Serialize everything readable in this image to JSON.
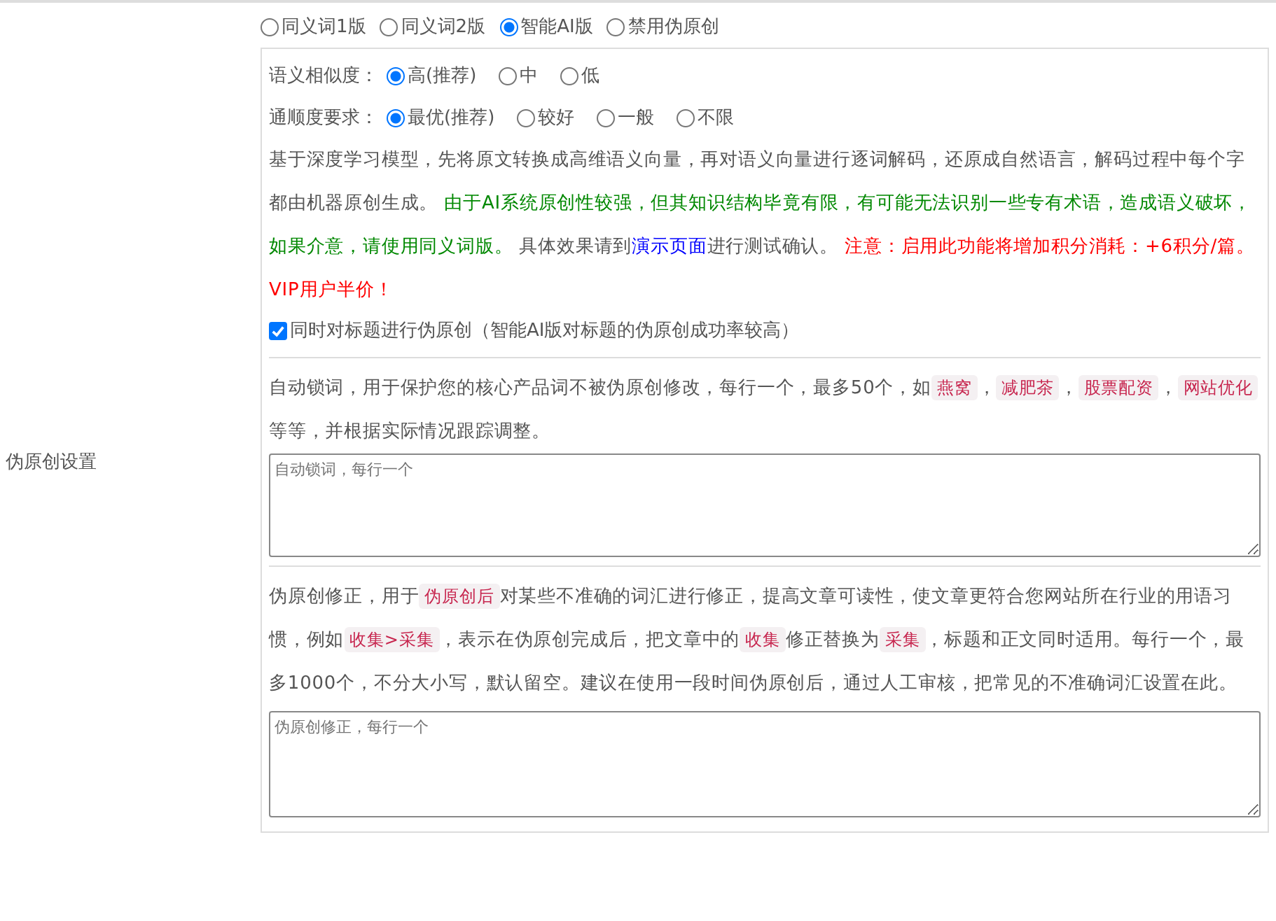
{
  "section_label": "伪原创设置",
  "modes": [
    {
      "label": "同义词1版",
      "selected": false
    },
    {
      "label": "同义词2版",
      "selected": false
    },
    {
      "label": "智能AI版",
      "selected": true
    },
    {
      "label": "禁用伪原创",
      "selected": false
    }
  ],
  "similarity": {
    "label": "语义相似度：",
    "options": [
      {
        "label": "高(推荐)",
        "selected": true
      },
      {
        "label": "中",
        "selected": false
      },
      {
        "label": "低",
        "selected": false
      }
    ]
  },
  "fluency": {
    "label": "通顺度要求：",
    "options": [
      {
        "label": "最优(推荐)",
        "selected": true
      },
      {
        "label": "较好",
        "selected": false
      },
      {
        "label": "一般",
        "selected": false
      },
      {
        "label": "不限",
        "selected": false
      }
    ]
  },
  "description": [
    {
      "kind": "text",
      "text": "基于深度学习模型，先将原文转换成高维语义向量，再对语义向量进行逐词解码，还原成自然语言，解码过程中每个字都由机器原创生成。 "
    },
    {
      "kind": "success",
      "text": "由于AI系统原创性较强，但其知识结构毕竟有限，有可能无法识别一些专有术语，造成语义破坏，如果介意，请使用同义词版。"
    },
    {
      "kind": "text",
      "text": " 具体效果请到"
    },
    {
      "kind": "link",
      "text": "演示页面"
    },
    {
      "kind": "text",
      "text": "进行测试确认。 "
    },
    {
      "kind": "warning",
      "text": "注意：启用此功能将增加积分消耗：+6积分/篇。VIP用户半价！"
    }
  ],
  "title_option": {
    "label": "同时对标题进行伪原创（智能AI版对标题的伪原创成功率较高）",
    "checked": true
  },
  "lock_words": {
    "description": [
      {
        "kind": "text",
        "text": "自动锁词，用于保护您的核心产品词不被伪原创修改，每行一个，最多50个，如"
      },
      {
        "kind": "tag",
        "text": "燕窝"
      },
      {
        "kind": "text",
        "text": "，"
      },
      {
        "kind": "tag",
        "text": "减肥茶"
      },
      {
        "kind": "text",
        "text": "，"
      },
      {
        "kind": "tag",
        "text": "股票配资"
      },
      {
        "kind": "text",
        "text": "，"
      },
      {
        "kind": "tag",
        "text": "网站优化"
      },
      {
        "kind": "text",
        "text": " 等等，并根据实际情况跟踪调整。"
      }
    ],
    "placeholder": "自动锁词，每行一个"
  },
  "corrections": {
    "description": [
      {
        "kind": "text",
        "text": "伪原创修正，用于"
      },
      {
        "kind": "tag",
        "text": "伪原创后"
      },
      {
        "kind": "text",
        "text": "对某些不准确的词汇进行修正，提高文章可读性，使文章更符合您网站所在行业的用语习惯，例如"
      },
      {
        "kind": "tag",
        "text": "收集>采集"
      },
      {
        "kind": "text",
        "text": "，表示在伪原创完成后，把文章中的"
      },
      {
        "kind": "tag",
        "text": "收集"
      },
      {
        "kind": "text",
        "text": "修正替换为"
      },
      {
        "kind": "tag",
        "text": "采集"
      },
      {
        "kind": "text",
        "text": "，标题和正文同时适用。每行一个，最多1000个，不分大小写，默认留空。建议在使用一段时间伪原创后，通过人工审核，把常见的不准确词汇设置在此。"
      }
    ],
    "placeholder": "伪原创修正，每行一个"
  }
}
